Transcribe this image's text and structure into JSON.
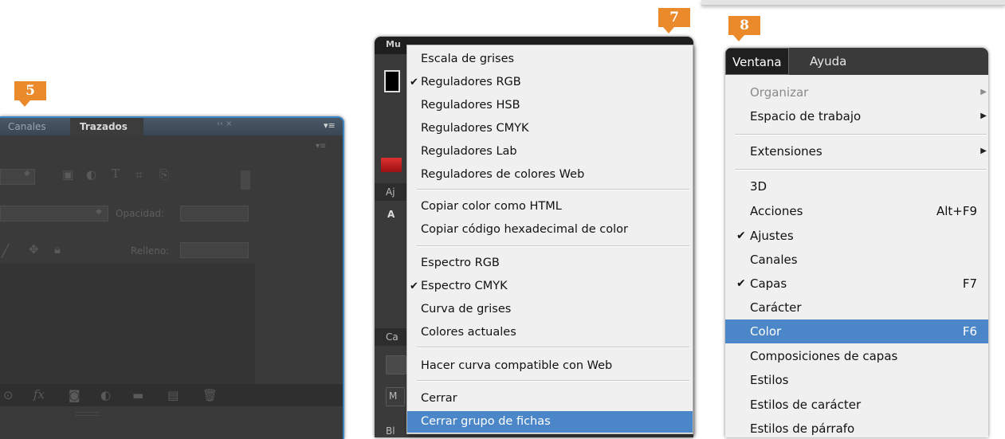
{
  "badges": {
    "b5": "5",
    "b7": "7",
    "b8": "8"
  },
  "panel5": {
    "tabs": {
      "canales": "Canales",
      "trazados": "Trazados"
    },
    "opacity_label": "Opacidad:",
    "fill_label": "Relleno:"
  },
  "panel7": {
    "tab_short": "Mu",
    "side_labels": {
      "aj": "Aj",
      "a": "A",
      "ca": "Ca",
      "m": "M",
      "bl": "Bl"
    },
    "menu": [
      {
        "label": "Escala de grises",
        "checked": false
      },
      {
        "label": "Reguladores RGB",
        "checked": true
      },
      {
        "label": "Reguladores HSB",
        "checked": false
      },
      {
        "label": "Reguladores CMYK",
        "checked": false
      },
      {
        "label": "Reguladores Lab",
        "checked": false
      },
      {
        "label": "Reguladores de colores Web",
        "checked": false
      },
      {
        "label": "Copiar color como HTML",
        "checked": false
      },
      {
        "label": "Copiar código hexadecimal de color",
        "checked": false
      },
      {
        "label": "Espectro RGB",
        "checked": false
      },
      {
        "label": "Espectro CMYK",
        "checked": true
      },
      {
        "label": "Curva de grises",
        "checked": false
      },
      {
        "label": "Colores actuales",
        "checked": false
      },
      {
        "label": "Hacer curva compatible con Web",
        "checked": false
      },
      {
        "label": "Cerrar",
        "checked": false
      },
      {
        "label": "Cerrar grupo de fichas",
        "checked": false,
        "highlighted": true
      }
    ]
  },
  "panel8": {
    "menubar": {
      "ventana": "Ventana",
      "ayuda": "Ayuda"
    },
    "menu": [
      {
        "label": "Organizar",
        "disabled": true,
        "submenu": true
      },
      {
        "label": "Espacio de trabajo",
        "submenu": true
      },
      {
        "label": "Extensiones",
        "submenu": true
      },
      {
        "label": "3D"
      },
      {
        "label": "Acciones",
        "shortcut": "Alt+F9"
      },
      {
        "label": "Ajustes",
        "checked": true
      },
      {
        "label": "Canales"
      },
      {
        "label": "Capas",
        "checked": true,
        "shortcut": "F7"
      },
      {
        "label": "Carácter"
      },
      {
        "label": "Color",
        "shortcut": "F6",
        "highlighted": true
      },
      {
        "label": "Composiciones de capas"
      },
      {
        "label": "Estilos"
      },
      {
        "label": "Estilos de carácter"
      },
      {
        "label": "Estilos de párrafo"
      }
    ]
  },
  "colors": {
    "highlight": "#4a86c8",
    "badge": "#ea8a2a",
    "panel_border": "#3d86c6"
  },
  "glyphs": {
    "check": "✔",
    "submenu_arrow": "▶",
    "panel_menu": "▾≡",
    "collapse": "‹‹  ×"
  }
}
